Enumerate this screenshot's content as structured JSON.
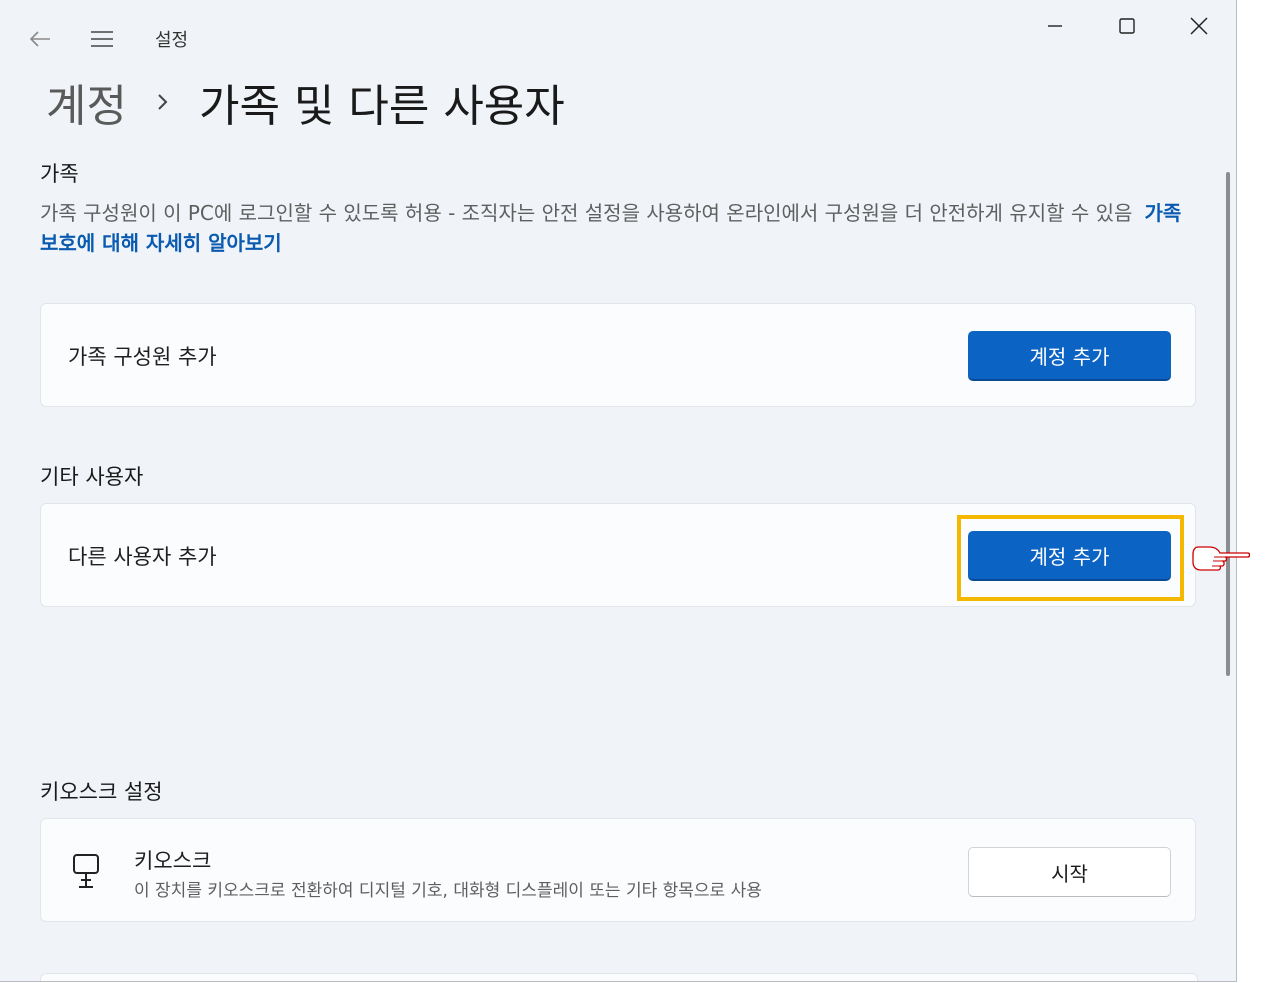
{
  "titlebar": {
    "app_title": "설정",
    "back_icon": "arrow-left-icon",
    "menu_icon": "hamburger-menu-icon",
    "minimize_icon": "minimize-icon",
    "maximize_icon": "maximize-icon",
    "close_icon": "close-icon"
  },
  "breadcrumb": {
    "parent": "계정",
    "separator_icon": "chevron-right-icon",
    "current": "가족 및 다른 사용자"
  },
  "family": {
    "title": "가족",
    "description": "가족 구성원이 이 PC에 로그인할 수 있도록 허용 - 조직자는 안전 설정을 사용하여 온라인에서 구성원을 더 안전하게 유지할 수 있음",
    "link": "가족 보호에 대해 자세히 알아보기",
    "card_label": "가족 구성원 추가",
    "button": "계정 추가"
  },
  "other_users": {
    "title": "기타 사용자",
    "card_label": "다른 사용자 추가",
    "button": "계정 추가"
  },
  "kiosk": {
    "title": "키오스크 설정",
    "icon": "kiosk-icon",
    "name": "키오스크",
    "description": "이 장치를 키오스크로 전환하여 디지털 기호, 대화형 디스플레이 또는 기타 항목으로 사용",
    "button": "시작"
  },
  "annotations": {
    "highlight_color": "#f5b800",
    "pointer_icon": "pointing-hand-icon",
    "pointer_color": "#cc0000"
  },
  "colors": {
    "accent": "#0b63c4",
    "link": "#0a5bb0",
    "background": "#f0f4f9"
  }
}
